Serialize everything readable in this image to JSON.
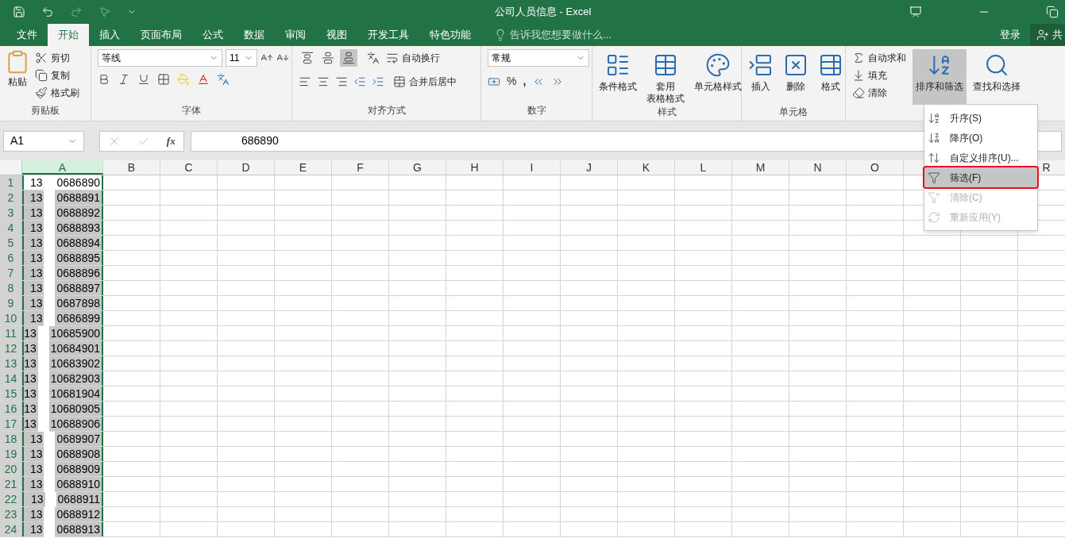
{
  "title_bar": {
    "title": "公司人员信息 - Excel"
  },
  "menu_tabs": [
    {
      "label": "文件",
      "selected": false
    },
    {
      "label": "开始",
      "selected": true
    },
    {
      "label": "插入",
      "selected": false
    },
    {
      "label": "页面布局",
      "selected": false
    },
    {
      "label": "公式",
      "selected": false
    },
    {
      "label": "数据",
      "selected": false
    },
    {
      "label": "审阅",
      "selected": false
    },
    {
      "label": "视图",
      "selected": false
    },
    {
      "label": "开发工具",
      "selected": false
    },
    {
      "label": "特色功能",
      "selected": false
    }
  ],
  "tell_me": {
    "placeholder": "告诉我您想要做什么..."
  },
  "account": {
    "sign_in": "登录",
    "share": "共"
  },
  "clipboard": {
    "paste": "粘贴",
    "cut": "剪切",
    "copy": "复制",
    "format_painter": "格式刷",
    "label": "剪贴板"
  },
  "font": {
    "font_name": "等线",
    "font_size": "11",
    "label": "字体"
  },
  "alignment": {
    "vertical_align": [
      {
        "selected": false
      },
      {
        "selected": false
      },
      {
        "selected": true
      }
    ],
    "wrap_text": "自动换行",
    "merge_center": "合并后居中",
    "label": "对齐方式"
  },
  "number": {
    "format": "常规",
    "percent": "%",
    "comma": ",",
    "label": "数字"
  },
  "styles": {
    "conditional": "条件格式",
    "table_format": [
      "套用",
      "表格格式"
    ],
    "cell_styles": "单元格样式",
    "label": "样式"
  },
  "cells": {
    "insert": "插入",
    "delete": "删除",
    "format": "格式",
    "label": "单元格"
  },
  "editing": {
    "autosum": "自动求和",
    "fill": "填充",
    "clear": "清除",
    "sort_filter": {
      "label": "排序和筛选",
      "selected": true
    },
    "find_select": "查找和选择"
  },
  "formula_bar": {
    "name_box": "A1",
    "function_label": "fx",
    "value": "686890"
  },
  "columns": [
    {
      "label": "A",
      "selected": true
    },
    {
      "label": "B",
      "selected": false
    },
    {
      "label": "C",
      "selected": false
    },
    {
      "label": "D",
      "selected": false
    },
    {
      "label": "E",
      "selected": false
    },
    {
      "label": "F",
      "selected": false
    },
    {
      "label": "G",
      "selected": false
    },
    {
      "label": "H",
      "selected": false
    },
    {
      "label": "I",
      "selected": false
    },
    {
      "label": "J",
      "selected": false
    },
    {
      "label": "K",
      "selected": false
    },
    {
      "label": "L",
      "selected": false
    },
    {
      "label": "M",
      "selected": false
    },
    {
      "label": "N",
      "selected": false
    },
    {
      "label": "O",
      "selected": false
    }
  ],
  "edge_column": {
    "label": "R"
  },
  "rows": [
    {
      "number": "1",
      "head": "13",
      "tail": "0686890",
      "active": true
    },
    {
      "number": "2",
      "head": "13",
      "tail": "0688891",
      "active": false
    },
    {
      "number": "3",
      "head": "13",
      "tail": "0688892",
      "active": false
    },
    {
      "number": "4",
      "head": "13",
      "tail": "0688893",
      "active": false
    },
    {
      "number": "5",
      "head": "13",
      "tail": "0688894",
      "active": false
    },
    {
      "number": "6",
      "head": "13",
      "tail": "0688895",
      "active": false
    },
    {
      "number": "7",
      "head": "13",
      "tail": "0688896",
      "active": false
    },
    {
      "number": "8",
      "head": "13",
      "tail": "0688897",
      "active": false
    },
    {
      "number": "9",
      "head": "13",
      "tail": "0687898",
      "active": false
    },
    {
      "number": "10",
      "head": "13",
      "tail": "0686899",
      "active": false
    },
    {
      "number": "11",
      "head": "13",
      "tail": "10685900",
      "active": false
    },
    {
      "number": "12",
      "head": "13",
      "tail": "10684901",
      "active": false
    },
    {
      "number": "13",
      "head": "13",
      "tail": "10683902",
      "active": false
    },
    {
      "number": "14",
      "head": "13",
      "tail": "10682903",
      "active": false
    },
    {
      "number": "15",
      "head": "13",
      "tail": "10681904",
      "active": false
    },
    {
      "number": "16",
      "head": "13",
      "tail": "10680905",
      "active": false
    },
    {
      "number": "17",
      "head": "13",
      "tail": "10688906",
      "active": false
    },
    {
      "number": "18",
      "head": "13",
      "tail": "0689907",
      "active": false
    },
    {
      "number": "19",
      "head": "13",
      "tail": "0688908",
      "active": false
    },
    {
      "number": "20",
      "head": "13",
      "tail": "0688909",
      "active": false
    },
    {
      "number": "21",
      "head": "13",
      "tail": "0688910",
      "active": false
    },
    {
      "number": "22",
      "head": "13",
      "tail": "0688911",
      "active": false
    },
    {
      "number": "23",
      "head": "13",
      "tail": "0688912",
      "active": false
    },
    {
      "number": "24",
      "head": "13",
      "tail": "0688913",
      "active": false
    }
  ],
  "sort_menu": [
    {
      "kind": "asc",
      "label": "升序(S)",
      "selected": false,
      "disabled": false
    },
    {
      "kind": "desc",
      "label": "降序(O)",
      "selected": false,
      "disabled": false
    },
    {
      "kind": "custom",
      "label": "自定义排序(U)...",
      "selected": false,
      "disabled": false
    },
    {
      "kind": "filter",
      "label": "筛选(F)",
      "selected": true,
      "disabled": false
    },
    {
      "kind": "clear",
      "label": "清除(C)",
      "selected": false,
      "disabled": true
    },
    {
      "kind": "reapply",
      "label": "重新应用(Y)",
      "selected": false,
      "disabled": true
    }
  ]
}
